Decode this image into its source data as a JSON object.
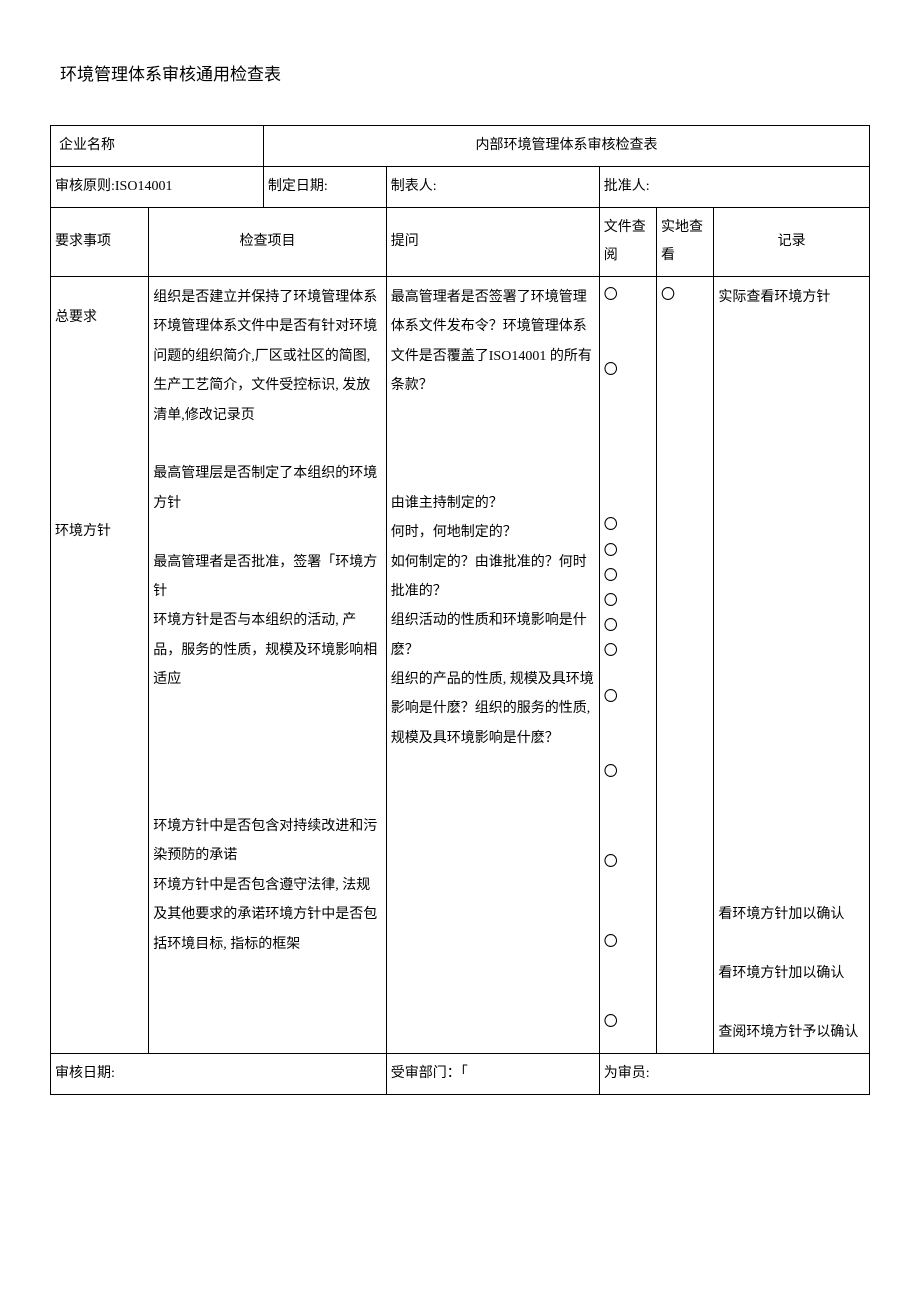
{
  "title": "环境管理体系审核通用检查表",
  "header": {
    "company_label": "企业名称",
    "form_title": "内部环境管理体系审核检查表",
    "principle_label": "审核原则:ISO14001",
    "date_label": "制定日期:",
    "preparer_label": "制表人:",
    "approver_label": "批准人:"
  },
  "columns": {
    "req": "要求事项",
    "item": "检查项目",
    "question": "提问",
    "doc": "文件查阅",
    "site": "实地查看",
    "record": "记录"
  },
  "body": {
    "req1": "总要求",
    "req2": "环境方针",
    "items": "组织是否建立并保持了环境管理体系\n环境管理体系文件中是否有针对环境问题的组织简介,厂区或社区的简图, 生产工艺简介，文件受控标识, 发放清单,修改记录页\n\n最高管理层是否制定了本组织的环境方针\n\n最高管理者是否批准，签署「环境方针\n环境方针是否与本组织的活动, 产品，服务的性质，规模及环境影响相适应\n\n\n\n\n环境方针中是否包含对持续改进和污染预防的承诺\n环境方针中是否包含遵守法律, 法规及其他要求的承诺环境方针中是否包括环境目标, 指标的框架",
    "questions": "最高管理者是否签署了环境管理体系文件发布令？环境管理体系文件是否覆盖了ISO14001 的所有条款？\n\n\n\n由谁主持制定的？\n何时，何地制定的？\n如何制定的？由谁批准的？何时批准的？\n组织活动的性质和环境影响是什麽？\n组织的产品的性质, 规模及具环境影响是什麽？组织的服务的性质, 规模及具环境影响是什麽？",
    "record_text": "实际查看环境方针\n\n\n\n\n\n\n\n\n\n\n\n\n\n\n\n\n\n\n\n\n看环境方针加以确认\n\n看环境方针加以确认\n\n查阅环境方针予以确认"
  },
  "footer": {
    "date": "审核日期:",
    "dept": "受审部门：「",
    "auditor": "为审员:"
  },
  "circle": "〇"
}
